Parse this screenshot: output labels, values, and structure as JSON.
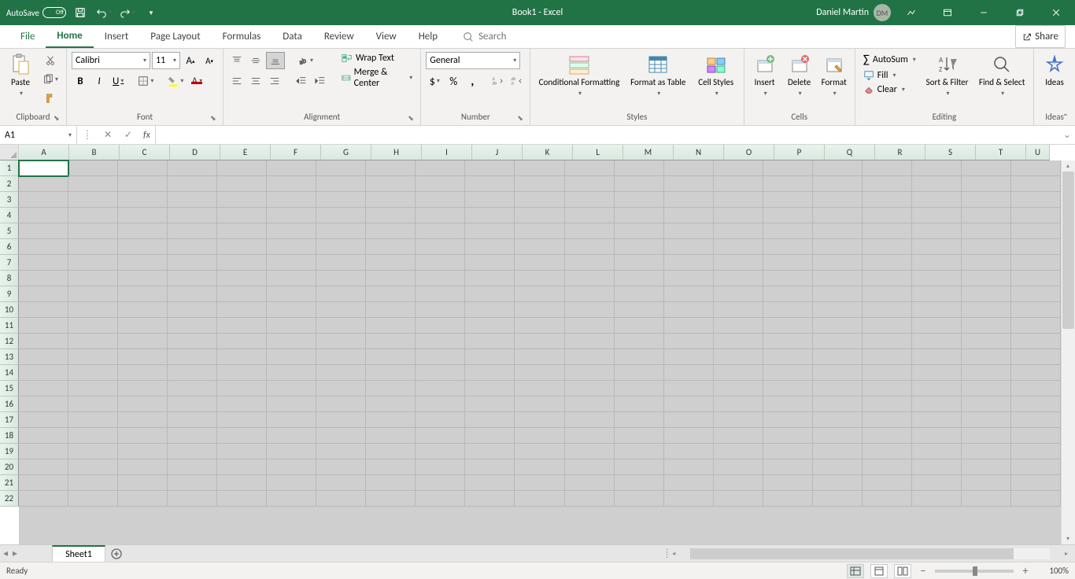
{
  "title_bar": {
    "autosave_label": "AutoSave",
    "autosave_state": "Off",
    "document_title": "Book1 - Excel",
    "user_name": "Daniel Martin",
    "user_initials": "DM"
  },
  "ribbon_tabs": {
    "file": "File",
    "tabs": [
      "Home",
      "Insert",
      "Page Layout",
      "Formulas",
      "Data",
      "Review",
      "View",
      "Help"
    ],
    "active": "Home",
    "search_placeholder": "Search",
    "share": "Share"
  },
  "ribbon": {
    "clipboard": {
      "label": "Clipboard",
      "paste": "Paste"
    },
    "font": {
      "label": "Font",
      "name": "Calibri",
      "size": "11"
    },
    "alignment": {
      "label": "Alignment",
      "wrap": "Wrap Text",
      "merge": "Merge & Center"
    },
    "number": {
      "label": "Number",
      "format": "General"
    },
    "styles": {
      "label": "Styles",
      "conditional": "Conditional Formatting",
      "format_table": "Format as Table",
      "cell_styles": "Cell Styles"
    },
    "cells": {
      "label": "Cells",
      "insert": "Insert",
      "delete": "Delete",
      "format": "Format"
    },
    "editing": {
      "label": "Editing",
      "autosum": "AutoSum",
      "fill": "Fill",
      "clear": "Clear",
      "sort": "Sort & Filter",
      "find": "Find & Select"
    },
    "ideas": {
      "label": "Ideas",
      "button": "Ideas"
    }
  },
  "formula_bar": {
    "name_box": "A1",
    "formula": ""
  },
  "grid": {
    "columns": [
      "A",
      "B",
      "C",
      "D",
      "E",
      "F",
      "G",
      "H",
      "I",
      "J",
      "K",
      "L",
      "M",
      "N",
      "O",
      "P",
      "Q",
      "R",
      "S",
      "T",
      "U"
    ],
    "rows": [
      1,
      2,
      3,
      4,
      5,
      6,
      7,
      8,
      9,
      10,
      11,
      12,
      13,
      14,
      15,
      16,
      17,
      18,
      19,
      20,
      21,
      22
    ],
    "active_cell": "A1"
  },
  "sheet_tabs": {
    "active": "Sheet1"
  },
  "status_bar": {
    "status": "Ready",
    "zoom": "100%"
  }
}
